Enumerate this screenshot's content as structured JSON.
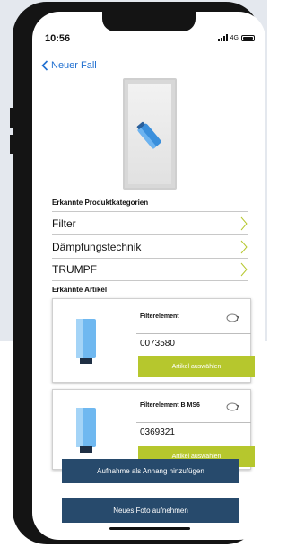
{
  "status": {
    "time": "10:56",
    "network": "4G"
  },
  "nav": {
    "back_label": "Neuer Fall"
  },
  "categories_title": "Erkannte Produktkategorien",
  "categories": [
    "Filter",
    "Dämpfungstechnik",
    "TRUMPF"
  ],
  "articles_title": "Erkannte Artikel",
  "articles": [
    {
      "name": "Filterelement",
      "number": "0073580",
      "button": "Artikel auswählen"
    },
    {
      "name": "Filterelement B MS6",
      "number": "0369321",
      "button": "Artikel auswählen"
    }
  ],
  "actions": {
    "attach_label": "Aufnahme als Anhang hinzufügen",
    "photo_label": "Neues Foto aufnehmen"
  },
  "colors": {
    "accent": "#b6c72d",
    "primary": "#274a6c",
    "link": "#1f6fd0"
  }
}
